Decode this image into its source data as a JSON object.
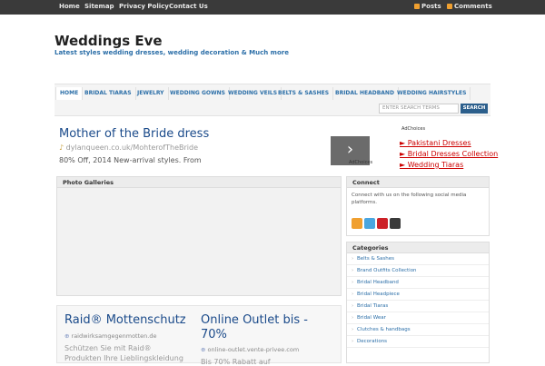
{
  "topbar": {
    "links": [
      "Home",
      "Sitemap",
      "Privacy Policy",
      "Contact Us"
    ],
    "posts": "Posts",
    "comments": "Comments"
  },
  "site": {
    "title": "Weddings Eve",
    "tagline": "Latest styles wedding dresses, wedding decoration & Much more"
  },
  "nav": {
    "items": [
      "HOME",
      "BRIDAL TIARAS",
      "JEWELRY",
      "WEDDING GOWNS",
      "WEDDING VEILS",
      "BELTS & SASHES",
      "BRIDAL HEADBAND",
      "WEDDING HAIRSTYLES"
    ],
    "search_placeholder": "ENTER SEARCH TERMS",
    "search_button": "SEARCH"
  },
  "ad_top": {
    "title": "Mother of the Bride dress",
    "url": "dylanqueen.co.uk/MohterofTheBride",
    "desc": "80% Off, 2014 New-arrival styles. From",
    "adchoices": "AdChoices",
    "arrow": "›"
  },
  "ad_links": {
    "adchoices": "AdChoices",
    "links": [
      "► Pakistani Dresses",
      "► Bridal Dresses Collection",
      "► Wedding Tiaras"
    ]
  },
  "photo": {
    "heading": "Photo Galleries"
  },
  "ad_bottom": {
    "left": {
      "title": "Raid® Mottenschutz",
      "url": "raidwirksamgegenmotten.de",
      "desc1": "Schützen Sie mit Raid®",
      "desc2": "Produkten Ihre Lieblingskleidung"
    },
    "right": {
      "title1": "Online Outlet bis -",
      "title2": "70%",
      "url": "online-outlet.vente-privee.com",
      "desc": "Bis 70% Rabatt auf"
    }
  },
  "connect": {
    "heading": "Connect",
    "text": "Connect with us on the following social media platforms.",
    "icons": [
      "rss-icon",
      "twitter-icon",
      "pinterest-icon",
      "google-plus-icon"
    ]
  },
  "categories": {
    "heading": "Categories",
    "items": [
      "Belts & Sashes",
      "Brand Outfits Collection",
      "Bridal Headband",
      "Bridal Headpiece",
      "Bridal Tiaras",
      "Bridal Wear",
      "Clutches & handbags",
      "Decorations"
    ]
  },
  "colors": {
    "accent": "#2c6fa8",
    "topbar": "#3a3a3a",
    "ad_link": "#cc0000"
  }
}
